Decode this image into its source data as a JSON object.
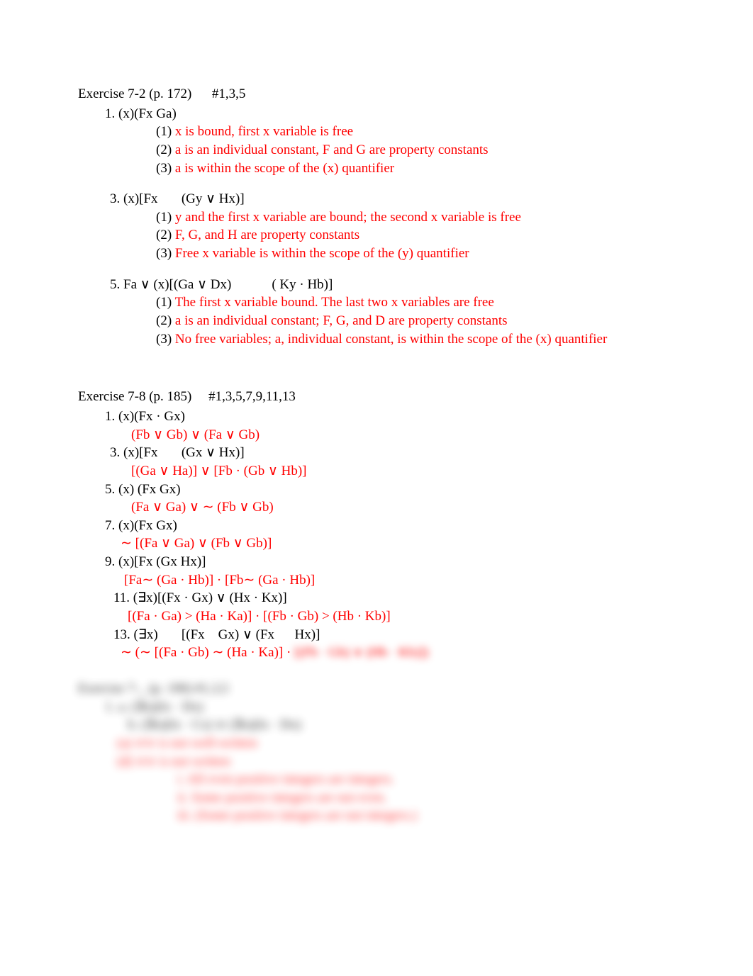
{
  "ex72": {
    "heading_a": "Exercise 7-2 (p. 172)",
    "heading_b": "#1,3,5",
    "p1": {
      "line": "1.   (x)(Fx  Ga)",
      "a1_n": "(1)",
      "a1": "x is bound, first x variable is free",
      "a2_n": "(2)",
      "a2": "a is an individual constant, F and G are property constants",
      "a3_n": "(3)",
      "a3": "a is within the scope of the (x) quantifier"
    },
    "p3": {
      "line_a": "3. (x)[Fx",
      "line_b": "(Gy ∨ Hx)]",
      "a1_n": "(1)",
      "a1": "y and the first x variable are bound; the second x variable is free",
      "a2_n": "(2)",
      "a2": "F, G, and H are property constants",
      "a3_n": "(3)",
      "a3": "Free x variable is within the scope of the (y) quantifier"
    },
    "p5": {
      "line_a": "5. Fa ∨ (x)[(Ga ∨ Dx)",
      "line_b": "( Ky · Hb)]",
      "a1_n": "(1)",
      "a1": "The first x variable bound. The last two x variables are free",
      "a2_n": "(2)",
      "a2": "a is an individual constant;  F, G, and D are property constants",
      "a3_n": "(3)",
      "a3": "No free variables; a, individual constant, is within the scope of the (x) quantifier"
    }
  },
  "ex78": {
    "heading_a": "Exercise 7-8 (p. 185)",
    "heading_b": "#1,3,5,7,9,11,13",
    "p1_line": "1.   (x)(Fx · Gx)",
    "p1_ans": "(Fb ∨ Gb) ∨ (Fa ∨ Gb)",
    "p3_line_a": "3. (x)[Fx",
    "p3_line_b": "(Gx ∨ Hx)]",
    "p3_ans": "[(Ga ∨ Ha)] ∨ [Fb · (Gb ∨ Hb)]",
    "p5_line": "5. (x)  (Fx  Gx)",
    "p5_ans_a": "(Fa ∨ Ga) ∨",
    "p5_ans_b": "∼ (Fb ∨ Gb)",
    "p7_line": "7. (x)(Fx  Gx)",
    "p7_ans": "∼ [(Fa ∨ Ga) ∨ (Fb ∨ Gb)]",
    "p9_line": "9. (x)[Fx  (Gx  Hx)]",
    "p9_ans": "[Fa∼ (Ga · Hb)] · [Fb∼ (Ga · Hb)]",
    "p11_line": "11. (∃x)[(Fx · Gx) ∨ (Hx · Kx)]",
    "p11_ans": "[(Fa · Ga) > (Ha · Ka)] · [(Fb · Gb) > (Hb · Kb)]",
    "p13_line_a": "13. (∃x)",
    "p13_line_b": "[(Fx",
    "p13_line_c": "Gx) ∨ (Fx",
    "p13_line_d": "Hx)]",
    "p13_ans_a": "∼  (∼ [(Fa · Gb) ∼   (Ha · Ka)] · ",
    "p13_ans_b": "[(Fb · Gb) ∨ (Hb · Kb)])"
  },
  "ex_hidden": {
    "heading": "Exercise 7-_  (p. 190)        #1,3,5",
    "l1": "1.   a.    (∃x)(Ix · Dx)",
    "l2": "b. (∃x)(Ix · Cx) ∨ (∃x)(Ix · Dx)",
    "l3": "(a) ∨∨ is not well-written",
    "l4": "(d) ∨∨ is not written",
    "sub1": "i.   All even positive integers are integers.",
    "sub2": "ii.  Some positive integers are not even.",
    "sub3": "iii.  (Some positive integers are not integers.)"
  }
}
